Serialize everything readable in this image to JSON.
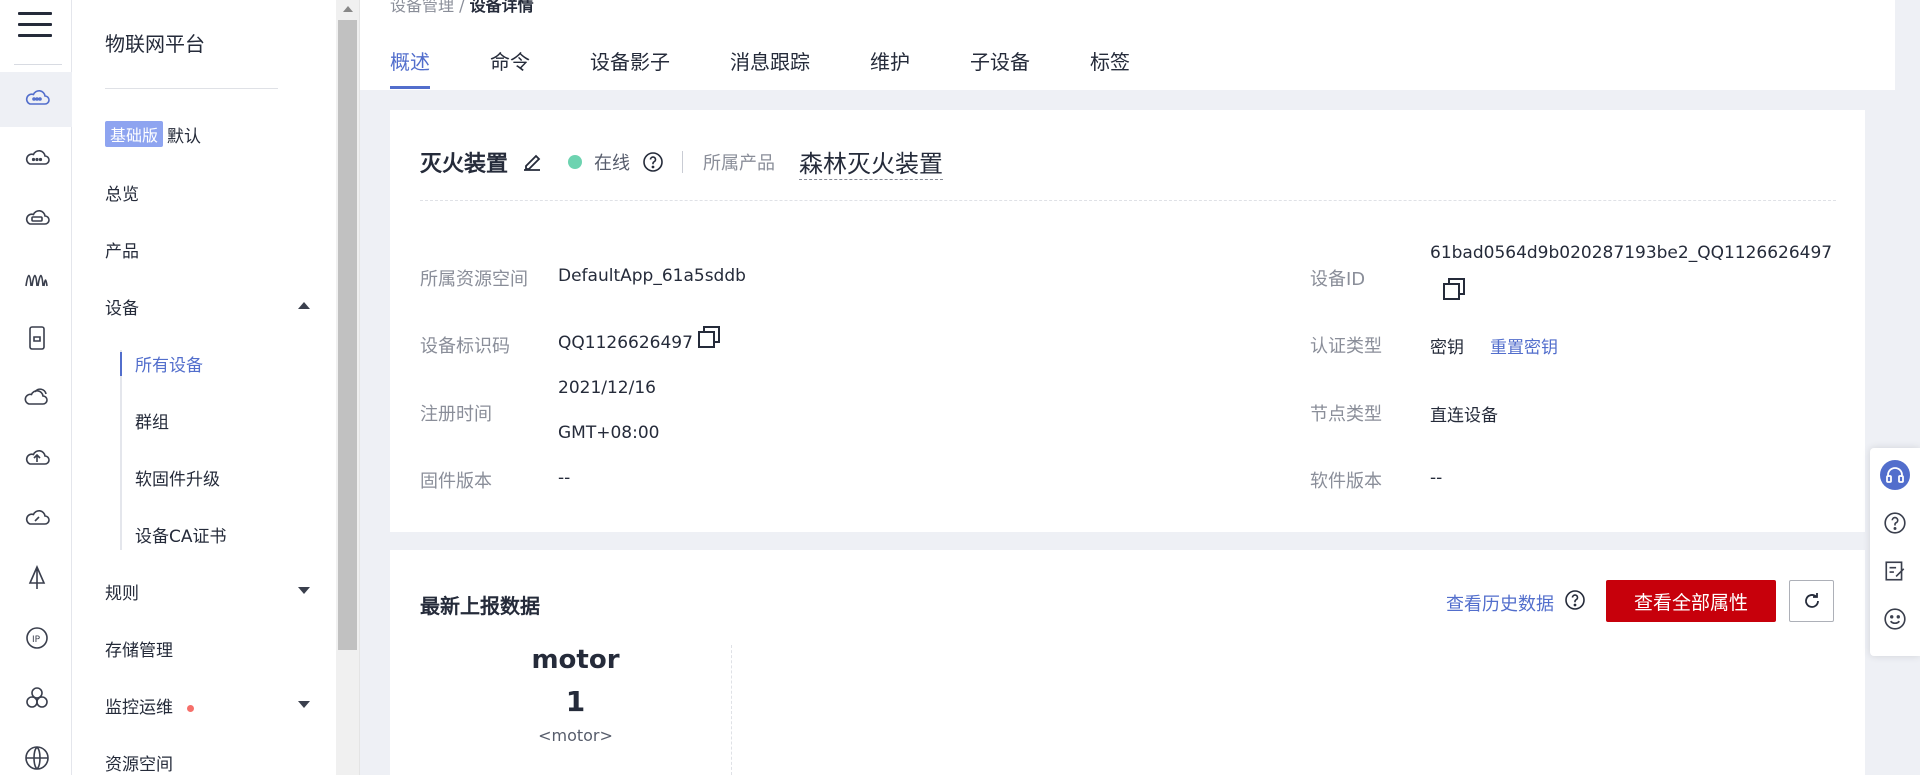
{
  "nav": {
    "title": "物联网平台",
    "plan_badge": "基础版",
    "plan_name": "默认",
    "items": {
      "overview": "总览",
      "product": "产品",
      "device": "设备",
      "all_devices": "所有设备",
      "group": "群组",
      "firmware": "软固件升级",
      "ca_cert": "设备CA证书",
      "rules": "规则",
      "storage": "存储管理",
      "monitoring": "监控运维",
      "resource_space": "资源空间"
    }
  },
  "breadcrumb": {
    "parent": "设备管理",
    "sep": " / ",
    "current": "设备详情"
  },
  "tabs": [
    "概述",
    "命令",
    "设备影子",
    "消息跟踪",
    "维护",
    "子设备",
    "标签"
  ],
  "device": {
    "name": "灭火装置",
    "status": "在线",
    "product_label": "所属产品",
    "product_value": "森林灭火装置",
    "fields": {
      "resource_space_label": "所属资源空间",
      "resource_space_value": "DefaultApp_61a5sddb",
      "device_id_label": "设备ID",
      "device_id_value": "61bad0564d9b020287193be2_QQ1126626497",
      "node_id_label": "设备标识码",
      "node_id_value": "QQ1126626497",
      "auth_type_label": "认证类型",
      "auth_type_value": "密钥",
      "reset_secret": "重置密钥",
      "register_time_label": "注册时间",
      "register_time_date": "2021/12/16",
      "register_time_tz": "GMT+08:00",
      "node_type_label": "节点类型",
      "node_type_value": "直连设备",
      "fw_version_label": "固件版本",
      "fw_version_value": "--",
      "sw_version_label": "软件版本",
      "sw_version_value": "--"
    }
  },
  "latest": {
    "title": "最新上报数据",
    "history_link": "查看历史数据",
    "all_props_button": "查看全部属性",
    "metric": {
      "name": "motor",
      "value": "1",
      "unit": "<motor>"
    }
  },
  "colors": {
    "accent": "#526ecc",
    "primary_button": "#c7000b",
    "online": "#6dd3b0"
  }
}
